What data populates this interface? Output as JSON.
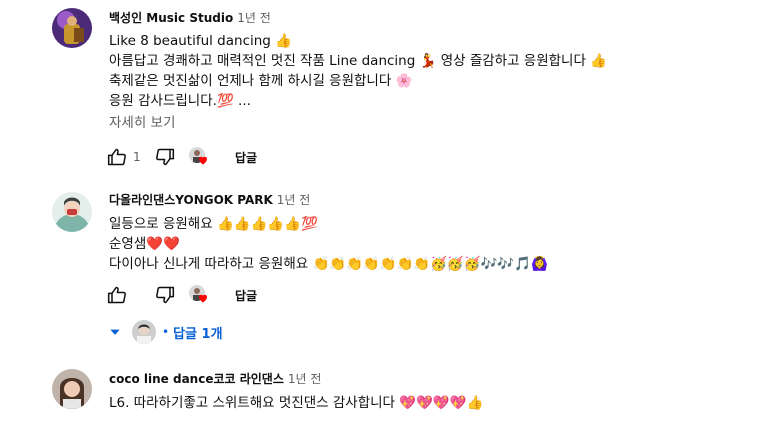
{
  "comments": [
    {
      "author": "백성인 Music Studio",
      "time": "1년 전",
      "lines": [
        "Like  8 beautiful dancing 👍",
        "아름답고 경쾌하고 매력적인 멋진 작품 Line dancing 💃 영상  즐감하고 응원합니다 👍",
        "축제같은 멋진삶이 언제나 함께 하시길 응원합니다 🌸",
        "응원 감사드립니다.💯 ..."
      ],
      "read_more": "자세히 보기",
      "like_count": "1",
      "reply_label": "답글"
    },
    {
      "author": "다올라인댄스YONGOK PARK",
      "time": "1년 전",
      "lines": [
        "일등으로 응원해요 👍👍👍👍👍💯",
        " 순영샘❤️❤️",
        "  다이아나  신나게  따라하고 응원해요 👏👏👏👏👏👏👏🥳🥳🥳🎶🎶🎵🙆‍♀️"
      ],
      "like_count": "",
      "reply_label": "답글",
      "replies_label": "답글 1개"
    },
    {
      "author": "coco line dance코코 라인댄스",
      "time": "1년 전",
      "lines": [
        "L6.    따라하기좋고 스위트해요 멋진댄스 감사합니다 💖💖💖💖👍"
      ]
    }
  ],
  "icons": {
    "like": "thumb-up-icon",
    "dislike": "thumb-down-icon",
    "heart": "creator-heart-icon",
    "expand": "caret-down-icon"
  },
  "colors": {
    "link_blue": "#065fd4",
    "heart_red": "#ff0000",
    "secondary_text": "#606060"
  }
}
